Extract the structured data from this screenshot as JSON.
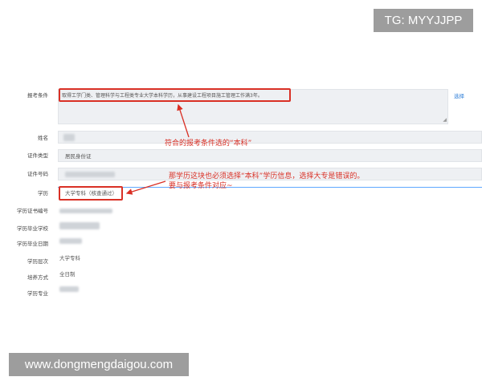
{
  "form": {
    "exam_condition": {
      "label": "报考条件",
      "value": "取得工学门类、管理科学与工程类专业大学本科学历，从事建设工程项目施工管理工作满3年。",
      "select_link": "选择"
    },
    "name": {
      "label": "姓名"
    },
    "id_type": {
      "label": "证件类型",
      "value": "居民身份证"
    },
    "id_number": {
      "label": "证件号码"
    },
    "education": {
      "label": "学历",
      "value": "大学专科（核查通过）"
    },
    "edu_cert_no": {
      "label": "学历证书编号"
    },
    "edu_school": {
      "label": "学历毕业学校"
    },
    "edu_grad_date": {
      "label": "学历毕业日期"
    },
    "edu_level": {
      "label": "学历层次",
      "value": "大学专科"
    },
    "study_mode": {
      "label": "培养方式",
      "value": "全日制"
    },
    "major": {
      "label": "学历专业"
    }
  },
  "annotations": {
    "note1": "符合的报考条件选的“本科”",
    "note2_line1": "那学历这块也必须选择“本科”学历信息，选择大专是错误的。",
    "note2_line2": "要与报考条件对应~"
  },
  "watermarks": {
    "tg": "TG: MYYJJPP",
    "site": "www.dongmengdaigou.com"
  },
  "colors": {
    "annotation_red": "#d93025",
    "field_bg": "#eef0f3",
    "link_blue": "#2f7fd8"
  }
}
